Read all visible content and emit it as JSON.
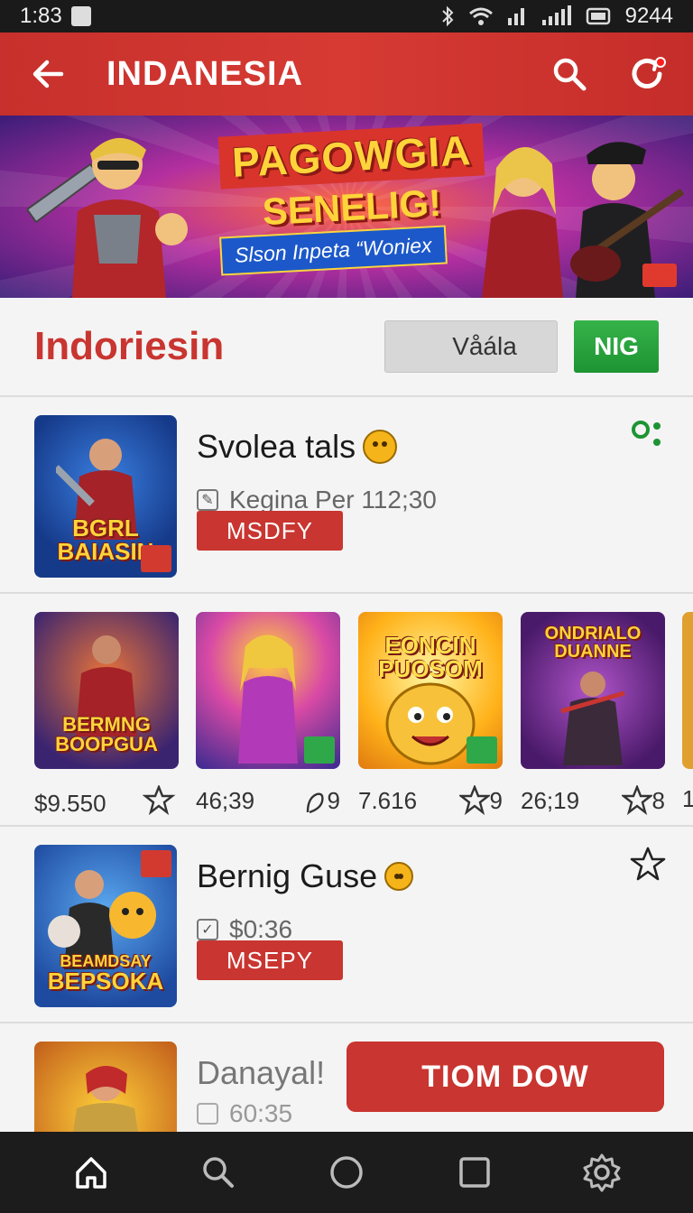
{
  "status_bar": {
    "time": "1:83",
    "battery_text": "9244"
  },
  "header": {
    "title": "INDANESIA"
  },
  "banner": {
    "headline_1": "PAGOWGIA",
    "headline_2": "SENELIG!",
    "subtitle": "Slson Inpeta “Woniex"
  },
  "section": {
    "title": "Indoriesin",
    "filter_value": "Våála",
    "go_label": "NIG"
  },
  "items": [
    {
      "name": "Svolea tals",
      "meta": "Kegina Per 112;30",
      "button": "MSDFY",
      "thumb_caption_1": "BGRL",
      "thumb_caption_2": "BAIASIN"
    },
    {
      "name": "Bernig Guse",
      "meta": "$0:36",
      "button": "MSEPY",
      "thumb_caption_1": "BEAMDSAY",
      "thumb_caption_2": "BEPSOKA"
    },
    {
      "name": "Danayal!",
      "meta": "60:35"
    }
  ],
  "carousel": [
    {
      "caption": "BERMNG BOOPGUA",
      "value": "$9.550"
    },
    {
      "caption": "",
      "value": "46;39"
    },
    {
      "caption": "EONCIN PUOSOM",
      "value": "7.616"
    },
    {
      "caption": "ONDRIALO DUANNE",
      "value": "26;19"
    },
    {
      "caption": "",
      "value": "1"
    }
  ],
  "carousel_star_labels": [
    "",
    "9",
    "9",
    "8"
  ],
  "cta": {
    "label": "TIOM DOW"
  },
  "colors": {
    "brand_red": "#c93530",
    "accent_green": "#1d9432",
    "nav_background": "#1c1c1c"
  },
  "icons": {
    "header": [
      "back-arrow-icon",
      "search-icon",
      "refresh-icon"
    ],
    "nav": [
      "home-icon",
      "search-icon",
      "circle-icon",
      "square-icon",
      "settings-icon"
    ]
  }
}
